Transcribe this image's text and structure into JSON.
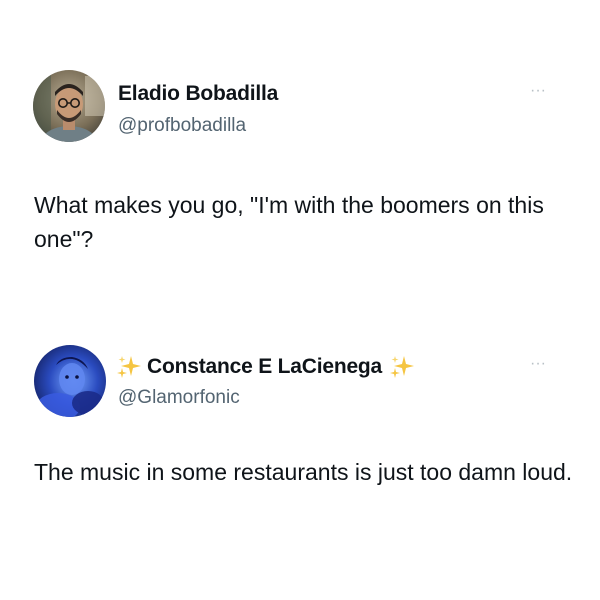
{
  "tweets": [
    {
      "display_name": "Eladio Bobadilla",
      "handle": "@profbobadilla",
      "text": "What makes you go, \"I'm with the boomers on this one\"?",
      "more_label": "···"
    },
    {
      "display_name": "Constance E LaCienega",
      "handle": "@Glamorfonic",
      "text": "The music in some restaurants is just too damn loud.",
      "more_label": "···",
      "name_decorations": [
        "sparkles-icon",
        "sparkles-icon"
      ]
    }
  ],
  "colors": {
    "text_primary": "#0f1419",
    "text_secondary": "#536471",
    "more_dots": "#b8c0c6",
    "sparkle": "#f5c542",
    "background": "#ffffff"
  }
}
